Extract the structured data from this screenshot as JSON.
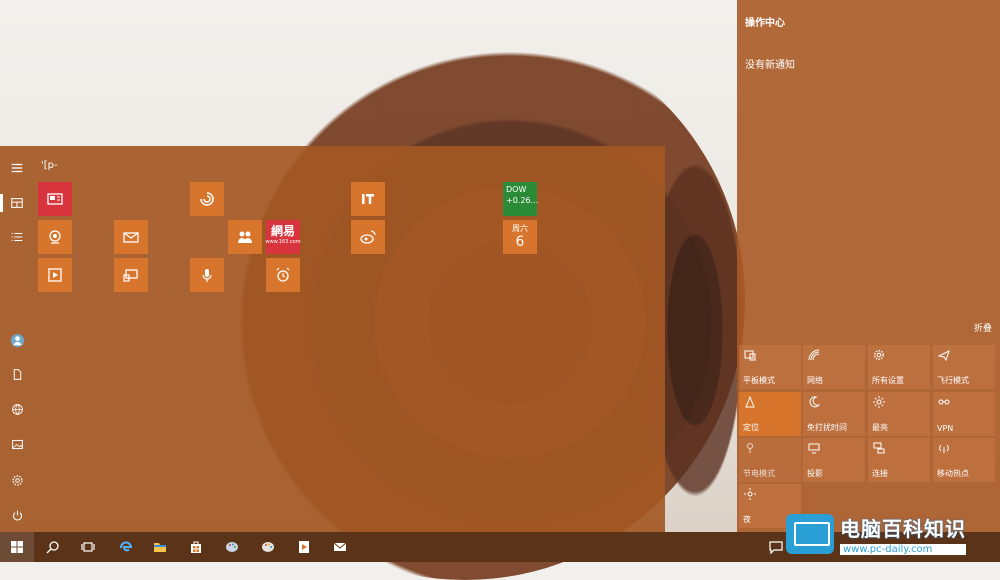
{
  "start_menu": {
    "search_fragment": "'[p-",
    "tiles": {
      "stock": {
        "line1": "DOW",
        "line2": "+0.26..."
      },
      "calendar": {
        "weekday": "周六",
        "day": "6"
      },
      "netease": {
        "brand": "網易",
        "url": "www.163.com"
      }
    }
  },
  "action_center": {
    "title": "操作中心",
    "no_notifications": "没有新通知",
    "collapse": "折叠",
    "quick_actions": [
      {
        "label": "平板模式",
        "icon": "tablet-mode-icon",
        "on": false
      },
      {
        "label": "网络",
        "icon": "network-icon",
        "on": false
      },
      {
        "label": "所有设置",
        "icon": "settings-icon",
        "on": false
      },
      {
        "label": "飞行模式",
        "icon": "airplane-icon",
        "on": false
      },
      {
        "label": "定位",
        "icon": "location-icon",
        "on": true
      },
      {
        "label": "免打扰时间",
        "icon": "moon-icon",
        "on": false
      },
      {
        "label": "最亮",
        "icon": "brightness-icon",
        "on": false
      },
      {
        "label": "VPN",
        "icon": "vpn-icon",
        "on": false
      },
      {
        "label": "节电模式",
        "icon": "battery-saver-icon",
        "on": false
      },
      {
        "label": "投影",
        "icon": "project-icon",
        "on": false
      },
      {
        "label": "连接",
        "icon": "connect-icon",
        "on": false
      },
      {
        "label": "移动热点",
        "icon": "hotspot-icon",
        "on": false
      },
      {
        "label": "夜",
        "icon": "night-light-icon",
        "on": false
      }
    ]
  },
  "watermark": {
    "title": "电脑百科知识",
    "url": "www.pc-daily.com"
  },
  "colors": {
    "accent": "#d8752d",
    "menu_bg": "#a45824",
    "taskbar": "#5b3318"
  }
}
